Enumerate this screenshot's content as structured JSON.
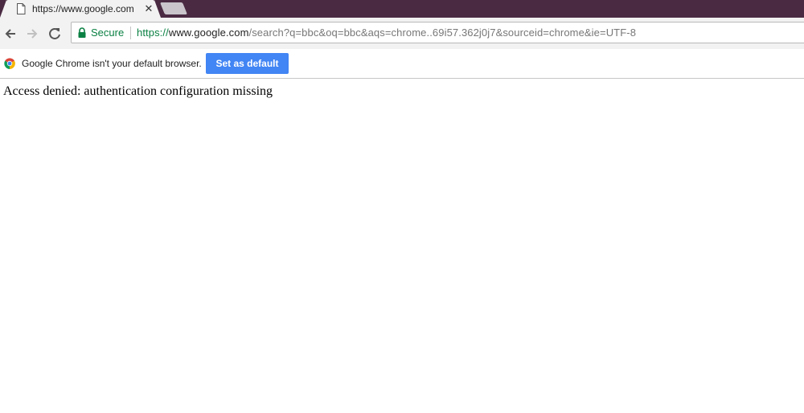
{
  "tab": {
    "title": "https://www.google.com",
    "close_glyph": "✕"
  },
  "omnibox": {
    "secure_label": "Secure",
    "url_scheme": "https://",
    "url_host": "www.google.com",
    "url_path": "/search?q=bbc&oq=bbc&aqs=chrome..69i57.362j0j7&sourceid=chrome&ie=UTF-8"
  },
  "infobar": {
    "message": "Google Chrome isn't your default browser.",
    "button_label": "Set as default"
  },
  "page": {
    "message": "Access denied: authentication configuration missing"
  },
  "colors": {
    "tabstrip": "#4a2a42",
    "secure_green": "#0b8043",
    "button_blue": "#4285f4"
  }
}
